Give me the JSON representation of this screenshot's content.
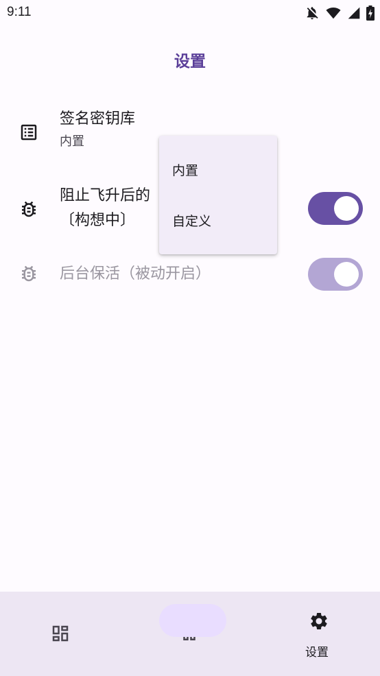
{
  "status_bar": {
    "time": "9:11",
    "icons": [
      "notifications-off-icon",
      "wifi-icon",
      "cell-signal-icon",
      "battery-charging-icon"
    ]
  },
  "page": {
    "title": "设置"
  },
  "settings": {
    "keystore": {
      "icon": "keystore-list-icon",
      "title": "签名密钥库",
      "value": "内置"
    },
    "prevent_upgrade": {
      "icon": "bug-icon",
      "title_line1": "阻止飞升后的",
      "title_line2": "〔构想中〕",
      "enabled": true
    },
    "keep_alive": {
      "icon": "bug-icon",
      "title": "后台保活（被动开启）",
      "enabled": true,
      "disabled": true
    }
  },
  "dropdown": {
    "options": [
      "内置",
      "自定义"
    ]
  },
  "bottom_nav": {
    "items": [
      {
        "icon": "dashboard-icon",
        "label": ""
      },
      {
        "icon": "home-icon",
        "label": ""
      },
      {
        "icon": "gear-icon",
        "label": "设置",
        "selected": true
      }
    ]
  },
  "colors": {
    "accent": "#6750a4",
    "title": "#5b3f99",
    "nav_background": "#ede6f3",
    "nav_indicator": "#e9ddff",
    "menu_background": "#f2ecf8"
  }
}
